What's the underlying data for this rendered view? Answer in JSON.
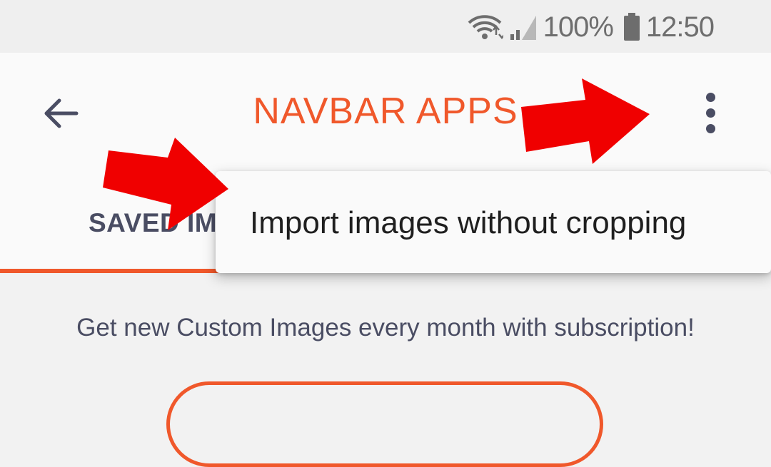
{
  "status_bar": {
    "battery_percent": "100%",
    "time": "12:50",
    "icons": [
      "wifi-icon",
      "signal-icon",
      "battery-icon"
    ]
  },
  "toolbar": {
    "title": "NAVBAR APPS",
    "back_icon": "arrow-left-icon",
    "overflow_icon": "more-vert-icon"
  },
  "tabs": [
    {
      "label": "SAVED IMAGES",
      "selected": true
    }
  ],
  "content": {
    "subtitle": "Get new Custom Images every month with subscription!"
  },
  "overflow_menu": {
    "items": [
      {
        "label": "Import images without cropping"
      }
    ]
  },
  "annotations": {
    "arrow_color": "#f00000"
  },
  "colors": {
    "accent": "#f0582b",
    "text_dark": "#4a4d63"
  }
}
